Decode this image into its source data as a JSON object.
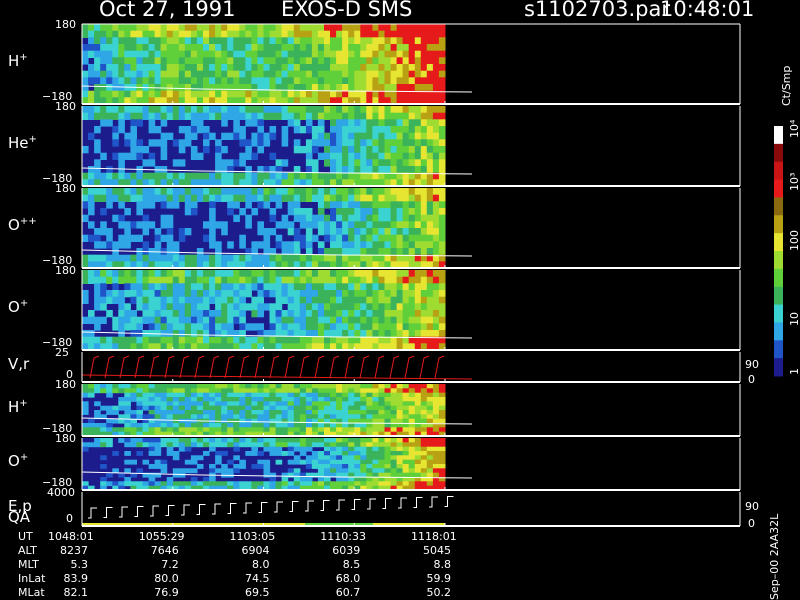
{
  "header": {
    "date": "Oct 27, 1991",
    "instrument": "EXOS-D SMS",
    "file": "s1102703.par",
    "time": "10:48:01"
  },
  "colorbar": {
    "unit": "Ct/Smp",
    "ticks": [
      "1",
      "10",
      "100",
      "10³",
      "10⁴"
    ],
    "colors": [
      "#1c1c8c",
      "#1f55c8",
      "#2fa6e6",
      "#3bd2d2",
      "#3bb35a",
      "#5fd03a",
      "#9edc32",
      "#e6e632",
      "#b8a214",
      "#8a6a10",
      "#e61a1a",
      "#c81414",
      "#8a0a0a",
      "#ffffff"
    ]
  },
  "footer_tag": "Sep–00 2AA32L",
  "panels": [
    {
      "id": "hp1",
      "name": "H",
      "sup": "+",
      "ytop": "180",
      "ybot": "−180"
    },
    {
      "id": "hep",
      "name": "He",
      "sup": "+",
      "ytop": "180",
      "ybot": "−180"
    },
    {
      "id": "opp",
      "name": "O",
      "sup": "++",
      "ytop": "180",
      "ybot": "−180"
    },
    {
      "id": "op1",
      "name": "O",
      "sup": "+",
      "ytop": "180",
      "ybot": "−180"
    },
    {
      "id": "vr",
      "name": "V,r",
      "sup": "",
      "ytop": "25",
      "ybot": "0",
      "rtop": "90",
      "rbot": "0"
    },
    {
      "id": "hp2",
      "name": "H",
      "sup": "+",
      "ytop": "180",
      "ybot": "−180"
    },
    {
      "id": "op2",
      "name": "O",
      "sup": "+",
      "ytop": "180",
      "ybot": "−180"
    },
    {
      "id": "ep",
      "name": "E,p",
      "sup": "",
      "ytop": "4000",
      "ybot": "0",
      "rtop": "90",
      "rbot": "0"
    }
  ],
  "qa_label": "QA",
  "ephemeris": {
    "rows": [
      {
        "label": "UT",
        "values": [
          "1048:01",
          "1055:29",
          "1103:05",
          "1110:33",
          "1118:01"
        ]
      },
      {
        "label": "ALT",
        "values": [
          "8237",
          "7646",
          "6904",
          "6039",
          "5045"
        ]
      },
      {
        "label": "MLT",
        "values": [
          "5.3",
          "7.2",
          "8.0",
          "8.5",
          "8.8"
        ]
      },
      {
        "label": "InLat",
        "values": [
          "83.9",
          "80.0",
          "74.5",
          "68.0",
          "59.9"
        ]
      },
      {
        "label": "MLat",
        "values": [
          "82.1",
          "76.9",
          "69.5",
          "60.7",
          "50.2"
        ]
      }
    ]
  },
  "chart_data": {
    "type": "heatmap",
    "x": [
      "1048:01",
      "1055:29",
      "1103:05",
      "1110:33",
      "1118:01"
    ],
    "series": [
      {
        "name": "H+",
        "profile": [
          2,
          5,
          4,
          6,
          9
        ],
        "ylim": [
          -180,
          180
        ]
      },
      {
        "name": "He+",
        "profile": [
          1,
          1,
          1,
          3,
          6
        ],
        "ylim": [
          -180,
          180
        ]
      },
      {
        "name": "O++",
        "profile": [
          1,
          1,
          1,
          3,
          6
        ],
        "ylim": [
          -180,
          180
        ]
      },
      {
        "name": "O+",
        "profile": [
          1,
          3,
          2,
          4,
          7
        ],
        "ylim": [
          -180,
          180
        ]
      },
      {
        "name": "H+",
        "profile": [
          1,
          3,
          3,
          4,
          7
        ],
        "ylim": [
          -180,
          180
        ]
      },
      {
        "name": "O+",
        "profile": [
          0,
          1,
          1,
          3,
          8
        ],
        "ylim": [
          -180,
          180
        ]
      }
    ],
    "colorbar_range": [
      1,
      10000
    ],
    "colorbar_scale": "log"
  }
}
